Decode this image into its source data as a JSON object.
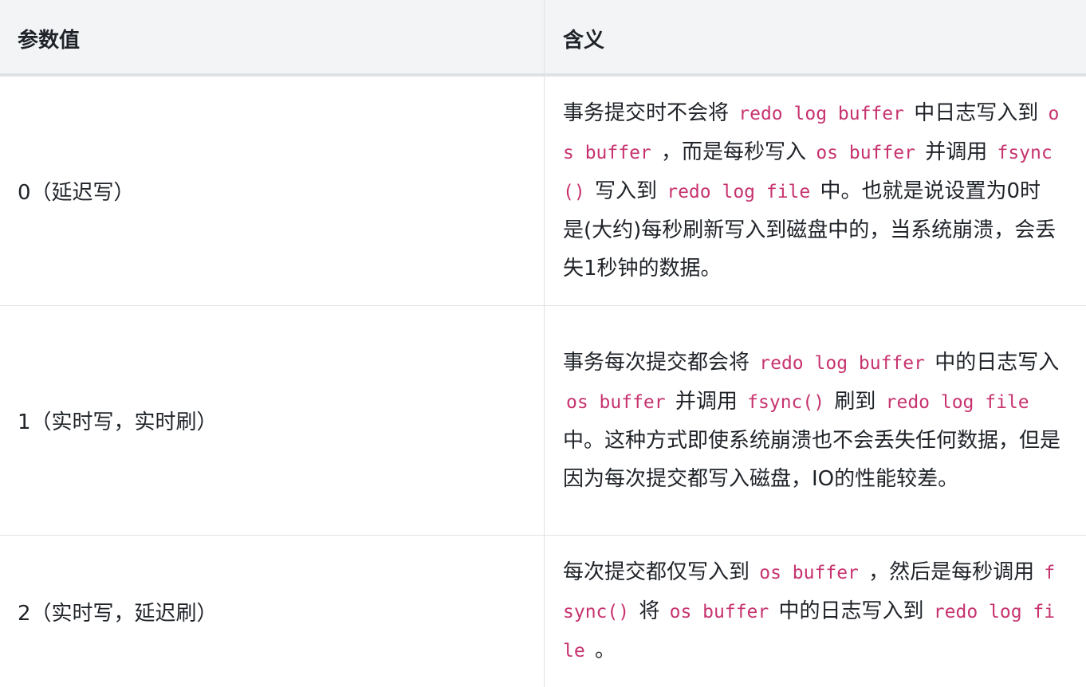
{
  "header": {
    "col1": "参数值",
    "col2": "含义"
  },
  "rows": [
    {
      "value": "0（延迟写）",
      "meaning": [
        {
          "t": "事务提交时不会将 "
        },
        {
          "c": "redo log buffer"
        },
        {
          "t": " 中日志写入到 "
        },
        {
          "c": "os buffer"
        },
        {
          "t": " ，而是每秒写入 "
        },
        {
          "c": "os buffer"
        },
        {
          "t": " 并调用 "
        },
        {
          "c": "fsync()"
        },
        {
          "t": " 写入到 "
        },
        {
          "c": "redo log file"
        },
        {
          "t": " 中。也就是说设置为0时是(大约)每秒刷新写入到磁盘中的，当系统崩溃，会丢失1秒钟的数据。"
        }
      ]
    },
    {
      "value": "1（实时写，实时刷）",
      "meaning": [
        {
          "t": "事务每次提交都会将 "
        },
        {
          "c": "redo log buffer"
        },
        {
          "t": " 中的日志写入 "
        },
        {
          "c": "os buffer"
        },
        {
          "t": " 并调用 "
        },
        {
          "c": "fsync()"
        },
        {
          "t": " 刷到 "
        },
        {
          "c": "redo log file"
        },
        {
          "t": " 中。这种方式即使系统崩溃也不会丢失任何数据，但是因为每次提交都写入磁盘，IO的性能较差。"
        }
      ]
    },
    {
      "value": "2（实时写，延迟刷）",
      "meaning": [
        {
          "t": "每次提交都仅写入到 "
        },
        {
          "c": "os buffer"
        },
        {
          "t": " ，然后是每秒调用 "
        },
        {
          "c": "fsync()"
        },
        {
          "t": " 将 "
        },
        {
          "c": "os buffer"
        },
        {
          "t": " 中的日志写入到 "
        },
        {
          "c": "redo log file"
        },
        {
          "t": " 。"
        }
      ]
    }
  ],
  "colors": {
    "code": "#c7336f",
    "header_bg": "#f3f4f6",
    "border": "#dfe2e5",
    "text": "#1f2328"
  }
}
